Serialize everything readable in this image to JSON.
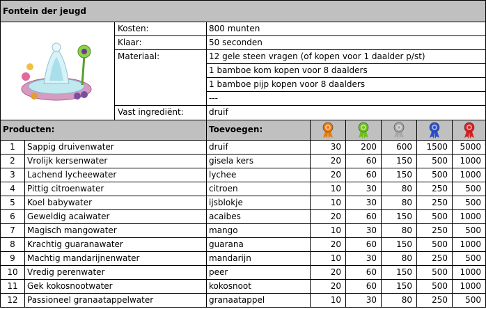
{
  "title": "Fontein der jeugd",
  "info": {
    "kosten_label": "Kosten:",
    "kosten_value": "800 munten",
    "klaar_label": "Klaar:",
    "klaar_value": "50 seconden",
    "materiaal_label": "Materiaal:",
    "materiaal": [
      "12 gele steen vragen (of kopen voor 1 daalder p/st)",
      "1 bamboe kom kopen voor 8 daalders",
      "1 bamboe pijp kopen voor 8 daalders",
      "---"
    ],
    "vast_label": "Vast ingrediënt:",
    "vast_value": "druif"
  },
  "headers": {
    "producten": "Producten:",
    "toevoegen": "Toevoegen:"
  },
  "medals": [
    {
      "icon": "orange-medal-icon",
      "color": "#e87a10"
    },
    {
      "icon": "green-medal-icon",
      "color": "#6cbf1c"
    },
    {
      "icon": "silver-medal-icon",
      "color": "#a9a9a9"
    },
    {
      "icon": "blue-medal-icon",
      "color": "#2a4fd0"
    },
    {
      "icon": "red-medal-icon",
      "color": "#d62020"
    }
  ],
  "products": [
    {
      "n": "1",
      "name": "Sappig druivenwater",
      "ing": "druif",
      "v": [
        "30",
        "200",
        "600",
        "1500",
        "5000"
      ]
    },
    {
      "n": "2",
      "name": "Vrolijk kersenwater",
      "ing": "gisela kers",
      "v": [
        "20",
        "60",
        "150",
        "500",
        "1000"
      ]
    },
    {
      "n": "3",
      "name": "Lachend lycheewater",
      "ing": "lychee",
      "v": [
        "20",
        "60",
        "150",
        "500",
        "1000"
      ]
    },
    {
      "n": "4",
      "name": "Pittig citroenwater",
      "ing": "citroen",
      "v": [
        "10",
        "30",
        "80",
        "250",
        "500"
      ]
    },
    {
      "n": "5",
      "name": "Koel babywater",
      "ing": "ijsblokje",
      "v": [
        "10",
        "30",
        "80",
        "250",
        "500"
      ]
    },
    {
      "n": "6",
      "name": "Geweldig acaiwater",
      "ing": "acaibes",
      "v": [
        "20",
        "60",
        "150",
        "500",
        "1000"
      ]
    },
    {
      "n": "7",
      "name": "Magisch mangowater",
      "ing": "mango",
      "v": [
        "10",
        "30",
        "80",
        "250",
        "500"
      ]
    },
    {
      "n": "8",
      "name": "Krachtig guaranawater",
      "ing": "guarana",
      "v": [
        "20",
        "60",
        "150",
        "500",
        "1000"
      ]
    },
    {
      "n": "9",
      "name": "Machtig mandarijnenwater",
      "ing": "mandarijn",
      "v": [
        "10",
        "30",
        "80",
        "250",
        "500"
      ]
    },
    {
      "n": "10",
      "name": "Vredig perenwater",
      "ing": "peer",
      "v": [
        "20",
        "60",
        "150",
        "500",
        "1000"
      ]
    },
    {
      "n": "11",
      "name": "Gek kokosnootwater",
      "ing": "kokosnoot",
      "v": [
        "20",
        "60",
        "150",
        "500",
        "1000"
      ]
    },
    {
      "n": "12",
      "name": "Passioneel granaatappelwater",
      "ing": "granaatappel",
      "v": [
        "10",
        "30",
        "80",
        "250",
        "500"
      ]
    }
  ]
}
